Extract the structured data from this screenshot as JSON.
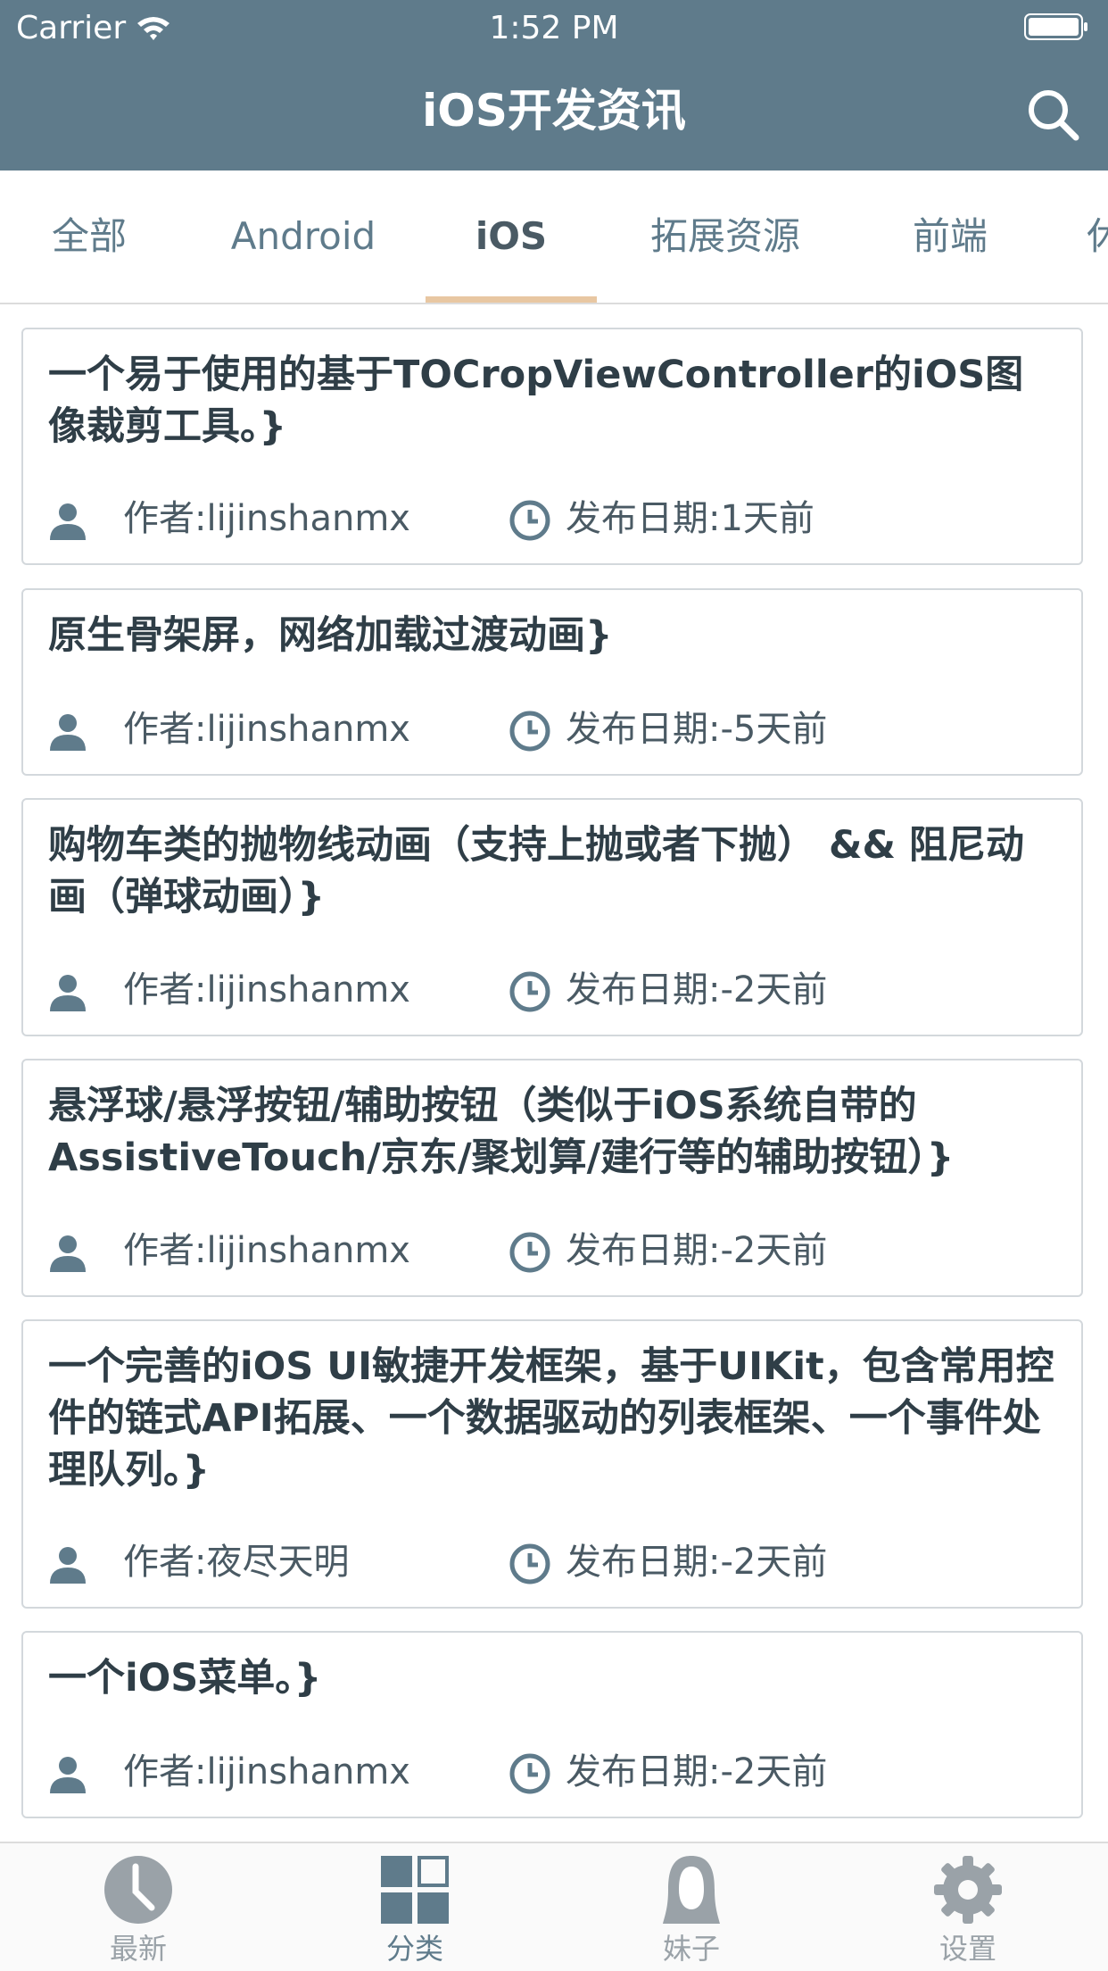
{
  "status_bar": {
    "carrier": "Carrier",
    "time": "1:52 PM"
  },
  "nav": {
    "title": "iOS开发资讯"
  },
  "tabs": [
    {
      "label": "全部"
    },
    {
      "label": "Android"
    },
    {
      "label": "iOS"
    },
    {
      "label": "拓展资源"
    },
    {
      "label": "前端"
    },
    {
      "label": "休"
    }
  ],
  "active_tab": "iOS",
  "colors": {
    "header": "#5f7b8b",
    "tab_indicator": "#e8c7a2",
    "text": "#2f3e47"
  },
  "articles": [
    {
      "title": "一个易于使用的基于TOCropViewController的iOS图像裁剪工具。}",
      "author": "作者:lijinshanmx",
      "date": "发布日期:1天前"
    },
    {
      "title": "原生骨架屏，网络加载过渡动画}",
      "author": "作者:lijinshanmx",
      "date": "发布日期:-5天前"
    },
    {
      "title": "购物车类的抛物线动画（支持上抛或者下抛） && 阻尼动画（弹球动画）}",
      "author": "作者:lijinshanmx",
      "date": "发布日期:-2天前"
    },
    {
      "title": "悬浮球/悬浮按钮/辅助按钮（类似于iOS系统自带的AssistiveTouch/京东/聚划算/建行等的辅助按钮）}",
      "author": "作者:lijinshanmx",
      "date": "发布日期:-2天前"
    },
    {
      "title": "一个完善的iOS UI敏捷开发框架，基于UIKit，包含常用控件的链式API拓展、一个数据驱动的列表框架、一个事件处理队列。}",
      "author": "作者:夜尽天明",
      "date": "发布日期:-2天前"
    },
    {
      "title": "一个iOS菜单。}",
      "author": "作者:lijinshanmx",
      "date": "发布日期:-2天前"
    }
  ],
  "tabbar": [
    {
      "label": "最新",
      "icon": "clock-icon"
    },
    {
      "label": "分类",
      "icon": "grid-icon"
    },
    {
      "label": "妹子",
      "icon": "girl-icon"
    },
    {
      "label": "设置",
      "icon": "gear-icon"
    }
  ],
  "active_tabbar": "分类"
}
